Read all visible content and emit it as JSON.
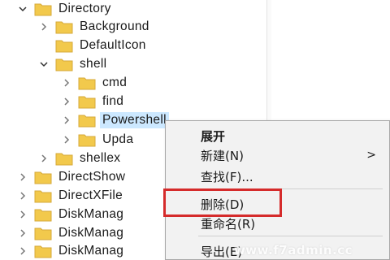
{
  "tree": {
    "nodes": [
      {
        "label": "Directory",
        "arrow": "expanded"
      },
      {
        "label": "Background",
        "arrow": "collapsed"
      },
      {
        "label": "DefaultIcon",
        "arrow": "none"
      },
      {
        "label": "shell",
        "arrow": "expanded"
      },
      {
        "label": "cmd",
        "arrow": "collapsed"
      },
      {
        "label": "find",
        "arrow": "collapsed"
      },
      {
        "label": "Powershell",
        "arrow": "collapsed",
        "selected": true
      },
      {
        "label": "Upda",
        "arrow": "collapsed"
      },
      {
        "label": "shellex",
        "arrow": "collapsed"
      },
      {
        "label": "DirectShow",
        "arrow": "collapsed"
      },
      {
        "label": "DirectXFile",
        "arrow": "collapsed"
      },
      {
        "label": "DiskManag",
        "arrow": "collapsed"
      },
      {
        "label": "DiskManag",
        "arrow": "collapsed"
      },
      {
        "label": "DiskManag",
        "arrow": "collapsed"
      }
    ]
  },
  "context_menu": {
    "items": [
      {
        "label": "展开",
        "bold": true
      },
      {
        "label": "新建(N)",
        "submenu": true
      },
      {
        "label": "查找(F)..."
      },
      {
        "label": "删除(D)",
        "highlighted": true
      },
      {
        "label": "重命名(R)"
      },
      {
        "label": "导出(E)"
      }
    ],
    "submenu_arrow": ">"
  },
  "watermark": "www.f7admin.cc",
  "colors": {
    "selection": "#cce8ff",
    "highlight_box": "#d52b2b",
    "folder": "#f2c94c",
    "menu_bg": "#f2f2f2"
  }
}
